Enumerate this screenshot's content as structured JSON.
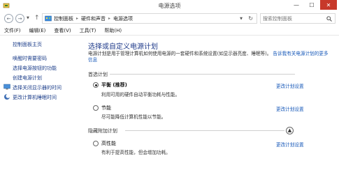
{
  "window": {
    "title": "电源选项",
    "minimize_glyph": "—",
    "maximize_glyph": "☐",
    "close_glyph": "✕"
  },
  "address": {
    "back_glyph": "←",
    "forward_glyph": "→",
    "dropdown_glyph": "▼",
    "up_glyph": "↑",
    "breadcrumbs": [
      "控制面板",
      "硬件和声音",
      "电源选项"
    ],
    "separator": "▸",
    "refresh_glyph": "↻",
    "search_placeholder": "搜索控制面板"
  },
  "menu": [
    "文件(F)",
    "编辑(E)",
    "查看(V)",
    "工具(T)",
    "帮助(H)"
  ],
  "sidebar": {
    "home": "控制面板主页",
    "links": [
      "唤醒时需要密码",
      "选择电源按钮的功能",
      "创建电源计划",
      "选择关闭显示器的时间",
      "更改计算机睡眠时间"
    ]
  },
  "main": {
    "heading": "选择或自定义电源计划",
    "intro": "电源计划是用于管理计算机如何使用电源的一套硬件和系统设置(如显示器亮度、睡眠等)。",
    "intro_link": "告诉我有关电源计划的更多信息",
    "preferred_label": "首选计划",
    "hidden_label": "隐藏附加计划",
    "change_link": "更改计划设置",
    "plans": [
      {
        "name": "平衡 (推荐)",
        "desc": "利用可用的硬件自动平衡功耗与性能。",
        "selected": true
      },
      {
        "name": "节能",
        "desc": "尽可能降低计算机性能以节能。",
        "selected": false
      },
      {
        "name": "高性能",
        "desc": "有利于提高性能，但会增加功耗。",
        "selected": false
      }
    ],
    "expand_glyph": "▲"
  },
  "colors": {
    "link": "#1557b8",
    "heading": "#1e3a8a",
    "close_button": "#c7392a"
  }
}
